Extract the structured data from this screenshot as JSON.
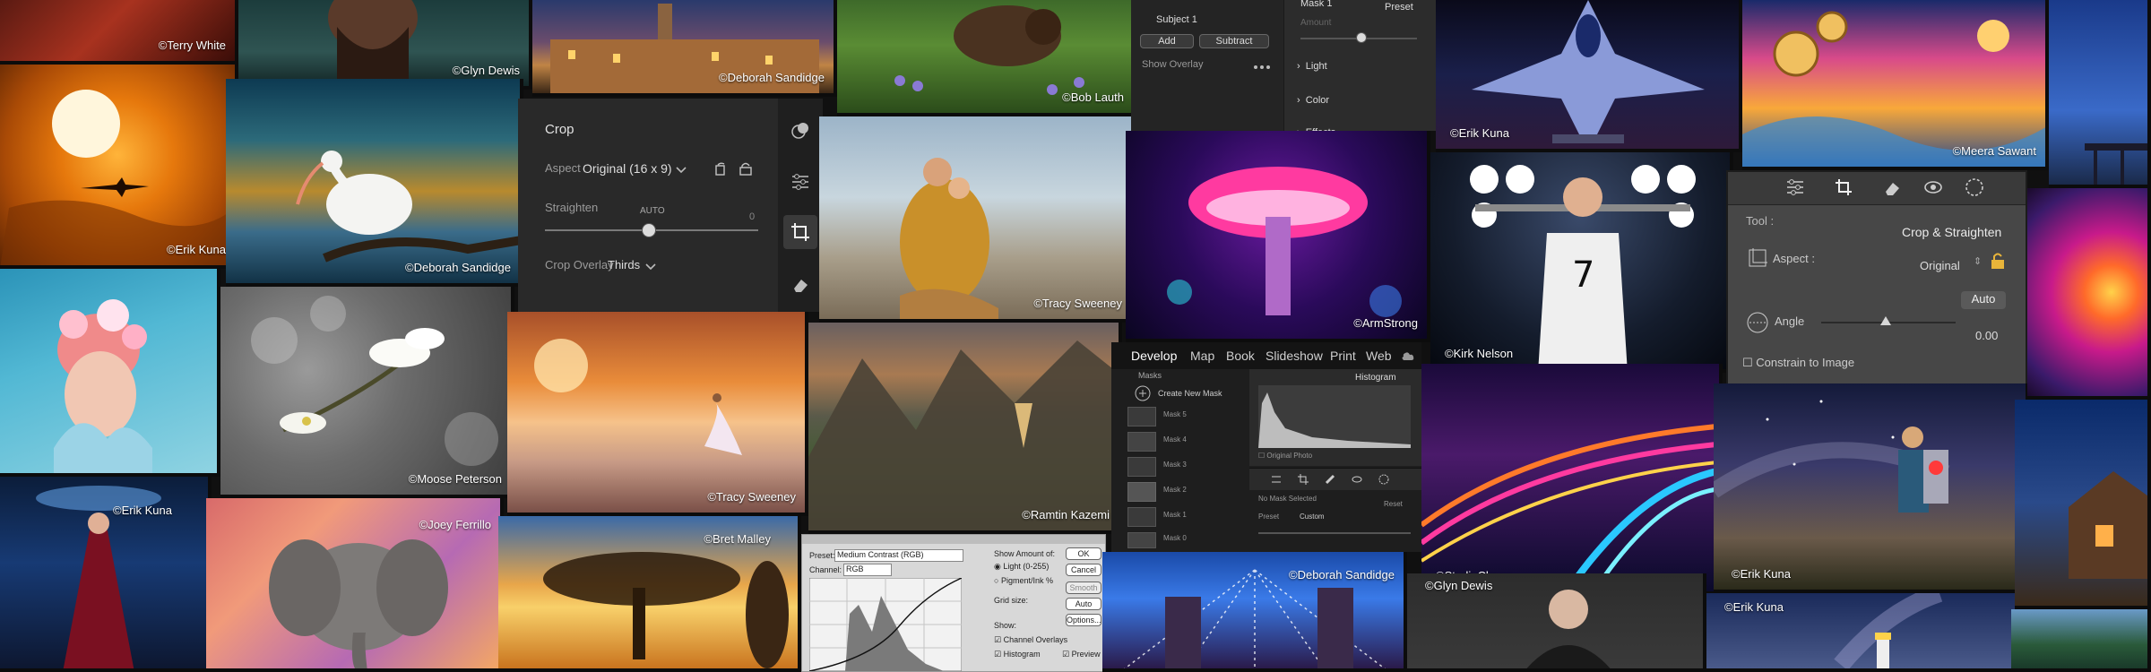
{
  "credits": {
    "terry_white": "©Terry White",
    "glyn_dewis": "©Glyn Dewis",
    "deborah_sandidge": "©Deborah Sandidge",
    "bob_lauth": "©Bob Lauth",
    "erik_kuna": "©Erik Kuna",
    "meera_sawant": "©Meera Sawant",
    "tracy_sweeney": "©Tracy Sweeney",
    "arm_strong": "©ArmStrong",
    "kirk_nelson": "©Kirk Nelson",
    "moose_peterson": "©Moose Peterson",
    "ramtin_kazemi": "©Ramtin Kazemi",
    "joey_ferrillo": "©Joey Ferrillo",
    "bret_malley": "©Bret Malley",
    "studio_clever": "©StudioClever"
  },
  "crop_panel": {
    "title": "Crop",
    "aspect_label": "Aspect",
    "aspect_value": "Original (16 x 9)",
    "straighten_label": "Straighten",
    "auto_label": "AUTO",
    "straighten_value": "0",
    "overlay_label": "Crop Overlay",
    "overlay_value": "Thirds"
  },
  "mask_panel": {
    "subject": "Subject 1",
    "add": "Add",
    "subtract": "Subtract",
    "show_overlay": "Show Overlay",
    "mask_title": "Mask 1",
    "preset": "Preset",
    "amount": "Amount",
    "sections": [
      "Light",
      "Color",
      "Effects"
    ]
  },
  "lrc_panel": {
    "tool_label": "Tool :",
    "tool_name": "Crop & Straighten",
    "aspect_label": "Aspect :",
    "aspect_value": "Original",
    "auto_btn": "Auto",
    "angle_label": "Angle",
    "angle_value": "0.00",
    "constrain_label": "Constrain to Image"
  },
  "develop_module": {
    "modules": [
      "Develop",
      "Map",
      "Book",
      "Slideshow",
      "Print",
      "Web"
    ],
    "masks_title": "Masks",
    "create_new_mask": "Create New Mask",
    "mask_items": [
      "Mask 5",
      "Mask 4",
      "Mask 3",
      "Mask 2",
      "Mask 1",
      "Mask 0"
    ],
    "histogram_label": "Histogram",
    "original_photo": "Original Photo",
    "no_mask": "No Mask Selected",
    "reset": "Reset",
    "preset_label": "Preset",
    "custom_label": "Custom"
  },
  "curves_dialog": {
    "preset_label": "Preset:",
    "preset_value": "Medium Contrast (RGB)",
    "channel_label": "Channel:",
    "channel_value": "RGB",
    "show_amount": "Show Amount of:",
    "light_option": "Light (0-255)",
    "pigment_option": "Pigment/Ink %",
    "grid_size": "Grid size:",
    "show_label": "Show:",
    "channel_overlays": "Channel Overlays",
    "histogram_option": "Histogram",
    "ok": "OK",
    "cancel": "Cancel",
    "smooth": "Smooth",
    "auto": "Auto",
    "options": "Options...",
    "preview": "Preview"
  }
}
